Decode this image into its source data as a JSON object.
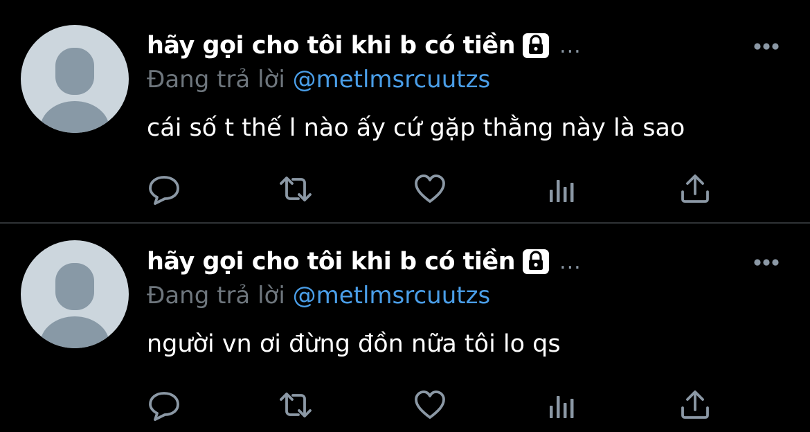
{
  "colors": {
    "background": "#000000",
    "divider": "#2f3336",
    "name": "#ffffff",
    "muted": "#6e767d",
    "handle": "#4a9ee8",
    "icon": "#8b98a5",
    "avatar_bg": "#ccd6dd",
    "avatar_fg": "#8899a6"
  },
  "tweets": [
    {
      "author": {
        "display_name": "hãy gọi cho tôi khi b có tiền",
        "protected_icon": "lock-icon",
        "overflow": "..."
      },
      "reply": {
        "prefix": "Đang trả lời",
        "handle": "@metlmsrcuutzs"
      },
      "text": "cái số t thế l nào ấy cứ gặp thằng này là sao",
      "actions": [
        "reply-icon",
        "retweet-icon",
        "like-icon",
        "analytics-icon",
        "share-icon"
      ]
    },
    {
      "author": {
        "display_name": "hãy gọi cho tôi khi b có tiền",
        "protected_icon": "lock-icon",
        "overflow": "..."
      },
      "reply": {
        "prefix": "Đang trả lời",
        "handle": "@metlmsrcuutzs"
      },
      "text": "người vn ơi đừng đồn nữa tôi lo qs",
      "actions": [
        "reply-icon",
        "retweet-icon",
        "like-icon",
        "analytics-icon",
        "share-icon"
      ]
    }
  ]
}
